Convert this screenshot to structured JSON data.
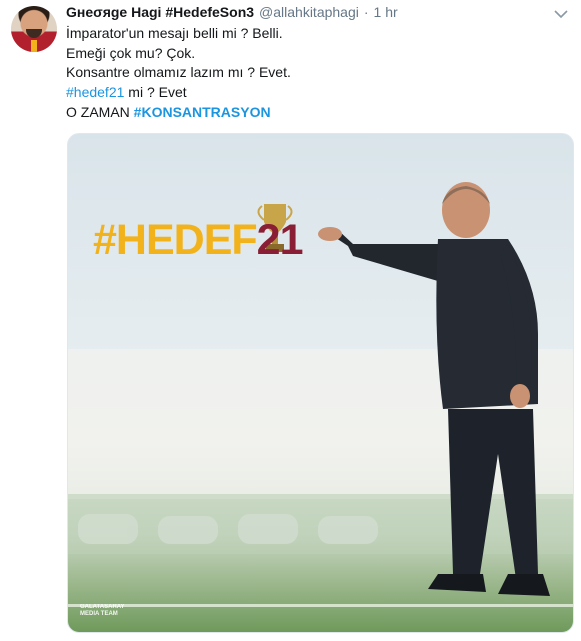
{
  "tweet": {
    "author_name": "Gнeσяge Hagi #HedefeSon3",
    "handle": "@allahkitaphagi",
    "separator": "·",
    "time": "1 hr",
    "lines": [
      "İmparator'un mesajı belli mi ? Belli.",
      "Emeği çok mu? Çok.",
      "Konsantre olmamız lazım mı ? Evet."
    ],
    "line4_hashtag": "#hedef21",
    "line4_rest": " mi ? Evet",
    "line5_text": "O ZAMAN ",
    "line5_hashtag": "#KONSANTRASYON"
  },
  "media": {
    "overlay_hash": "#HEDEF",
    "overlay_number": "21",
    "logo_text_1": "GALATASARAY",
    "logo_text_2": "MEDIA TEAM"
  },
  "icons": {
    "avatar": "avatar-image",
    "caret": "chevron-down-icon",
    "trophy": "trophy-icon"
  },
  "colors": {
    "link": "#1b95e0",
    "hashtag_overlay_yellow": "#f2b21b",
    "hashtag_overlay_red": "#8a1e34"
  }
}
